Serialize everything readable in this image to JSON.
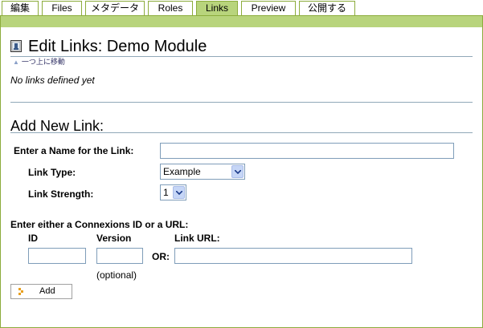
{
  "tabs": [
    {
      "label": "編集",
      "active": false
    },
    {
      "label": "Files",
      "active": false
    },
    {
      "label": "メタデータ",
      "active": false
    },
    {
      "label": "Roles",
      "active": false
    },
    {
      "label": "Links",
      "active": true
    },
    {
      "label": "Preview",
      "active": false
    },
    {
      "label": "公開する",
      "active": false
    }
  ],
  "page": {
    "title": "Edit Links: Demo Module",
    "up_link": "一つ上に移動",
    "no_links": "No links defined yet"
  },
  "form": {
    "section_title": "Add New Link:",
    "name_label": "Enter a Name for the Link:",
    "name_value": "",
    "type_label": "Link Type:",
    "type_selected": "Example",
    "strength_label": "Link Strength:",
    "strength_selected": "1",
    "either_label": "Enter either a Connexions ID or a URL:",
    "id_label": "ID",
    "version_label": "Version",
    "url_label": "Link URL:",
    "or_label": "OR:",
    "optional_note": "(optional)",
    "add_label": "Add"
  },
  "colors": {
    "accent_green": "#b8d47c",
    "border_green": "#8cac3c",
    "rule_blue": "#90a8b8"
  }
}
